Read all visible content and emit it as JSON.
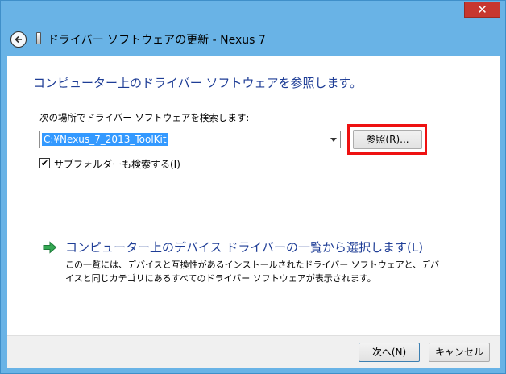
{
  "window": {
    "title": "ドライバー ソフトウェアの更新 - Nexus 7",
    "close_glyph": "✕"
  },
  "main": {
    "heading": "コンピューター上のドライバー ソフトウェアを参照します。",
    "search_label": "次の場所でドライバー ソフトウェアを検索します:",
    "path_value": "C:¥Nexus_7_2013_ToolKit",
    "browse_label": "参照(R)...",
    "include_subfolders_label": "サブフォルダーも検索する(I)",
    "include_subfolders_checked": true,
    "pick_link_label": "コンピューター上のデバイス ドライバーの一覧から選択します(L)",
    "pick_link_description": "この一覧には、デバイスと互換性があるインストールされたドライバー ソフトウェアと、デバイスと同じカテゴリにあるすべてのドライバー ソフトウェアが表示されます。"
  },
  "footer": {
    "next_label": "次へ(N)",
    "cancel_label": "キャンセル"
  },
  "colors": {
    "frame": "#69b3e6",
    "close": "#c7372f",
    "heading_text": "#1e3d96",
    "highlight": "#ee1111",
    "selection": "#3399ff"
  },
  "icons": {
    "back": "back-arrow-icon",
    "title": "usb-device-icon",
    "link": "green-arrow-icon",
    "close": "close-icon"
  }
}
